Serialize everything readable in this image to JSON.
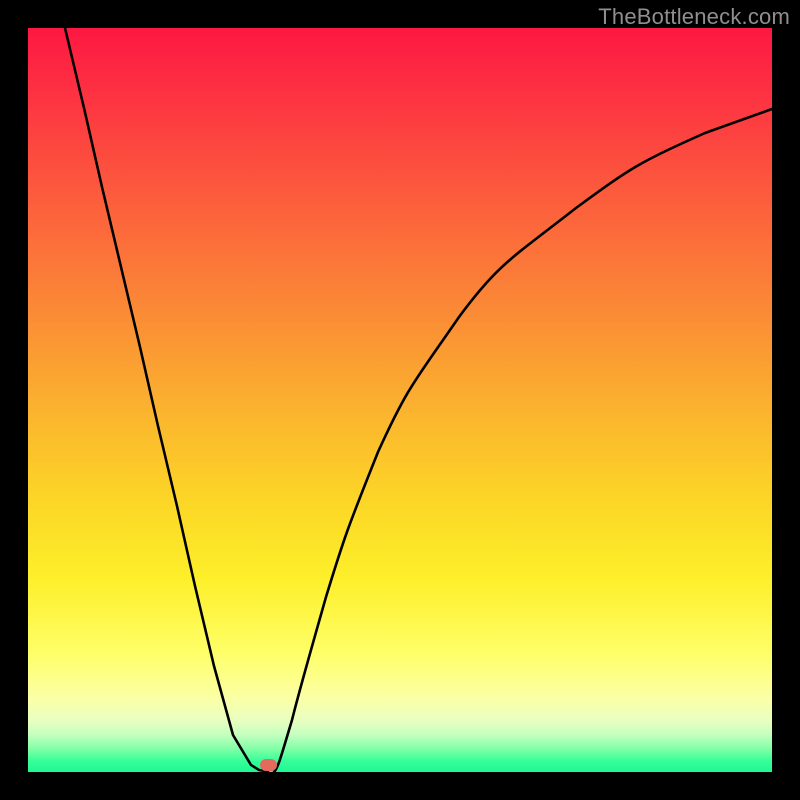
{
  "watermark": "TheBottleneck.com",
  "colors": {
    "frame": "#000000",
    "curve": "#000000",
    "marker": "#e46a5e"
  },
  "chart_data": {
    "type": "line",
    "title": "",
    "xlabel": "",
    "ylabel": "",
    "xlim": [
      0,
      1
    ],
    "ylim": [
      0,
      1
    ],
    "series": [
      {
        "name": "left-branch",
        "x": [
          0.05,
          0.075,
          0.1,
          0.125,
          0.15,
          0.175,
          0.2,
          0.225,
          0.25,
          0.275,
          0.3,
          0.31,
          0.318,
          0.322
        ],
        "y": [
          1.0,
          0.893,
          0.786,
          0.679,
          0.571,
          0.464,
          0.357,
          0.25,
          0.143,
          0.05,
          0.01,
          0.003,
          0.001,
          0.0
        ]
      },
      {
        "name": "right-branch",
        "x": [
          0.33,
          0.34,
          0.355,
          0.375,
          0.4,
          0.43,
          0.47,
          0.52,
          0.58,
          0.65,
          0.73,
          0.82,
          0.91,
          1.0
        ],
        "y": [
          0.0,
          0.02,
          0.07,
          0.145,
          0.235,
          0.33,
          0.43,
          0.525,
          0.61,
          0.685,
          0.745,
          0.795,
          0.83,
          0.855
        ]
      }
    ],
    "marker": {
      "x": 0.322,
      "y": 0.0
    },
    "background_gradient": {
      "direction": "vertical",
      "stops": [
        {
          "pos": 0.0,
          "color": "#fd1842"
        },
        {
          "pos": 0.22,
          "color": "#fc5a3d"
        },
        {
          "pos": 0.52,
          "color": "#fbb52e"
        },
        {
          "pos": 0.74,
          "color": "#fdef2a"
        },
        {
          "pos": 0.9,
          "color": "#fcffa4"
        },
        {
          "pos": 1.0,
          "color": "#1ef893"
        }
      ]
    }
  }
}
